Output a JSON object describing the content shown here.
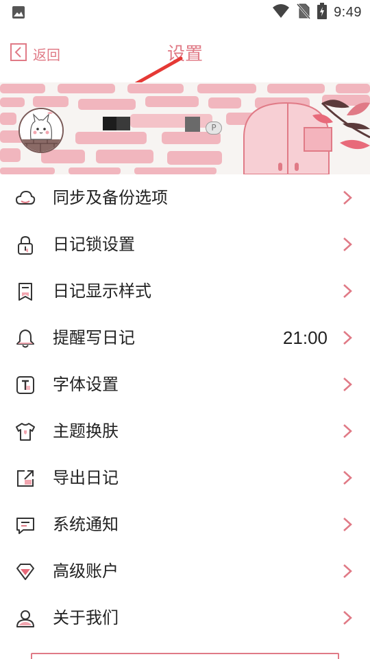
{
  "status_bar": {
    "time": "9:49",
    "icons": [
      "photo-icon",
      "wifi-icon",
      "no-sim-icon",
      "battery-charging-icon"
    ]
  },
  "header": {
    "back_label": "返回",
    "title": "设置"
  },
  "profile": {
    "vip_badge": "P"
  },
  "menu": {
    "items": [
      {
        "label": "同步及备份选项",
        "icon": "cloud-icon",
        "value": ""
      },
      {
        "label": "日记锁设置",
        "icon": "lock-icon",
        "value": ""
      },
      {
        "label": "日记显示样式",
        "icon": "bookmark-icon",
        "value": ""
      },
      {
        "label": "提醒写日记",
        "icon": "bell-icon",
        "value": "21:00"
      },
      {
        "label": "字体设置",
        "icon": "font-icon",
        "value": ""
      },
      {
        "label": "主题换肤",
        "icon": "tshirt-icon",
        "value": ""
      },
      {
        "label": "导出日记",
        "icon": "export-icon",
        "value": ""
      },
      {
        "label": "系统通知",
        "icon": "message-icon",
        "value": ""
      },
      {
        "label": "高级账户",
        "icon": "diamond-icon",
        "value": ""
      },
      {
        "label": "关于我们",
        "icon": "user-icon",
        "value": ""
      }
    ]
  },
  "colors": {
    "accent": "#e07a86",
    "accent_fill": "#f2a6b0",
    "icon_stroke": "#333333",
    "brick": "#f1b6be"
  }
}
